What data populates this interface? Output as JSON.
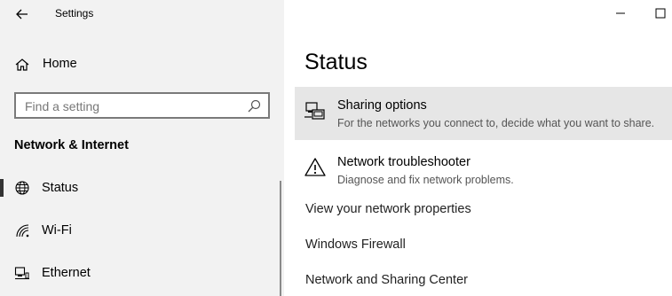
{
  "window": {
    "title": "Settings"
  },
  "sidebar": {
    "home_label": "Home",
    "search_placeholder": "Find a setting",
    "section_heading": "Network & Internet",
    "items": [
      {
        "label": "Status",
        "icon": "globe-icon",
        "selected": true
      },
      {
        "label": "Wi-Fi",
        "icon": "wifi-icon",
        "selected": false
      },
      {
        "label": "Ethernet",
        "icon": "ethernet-icon",
        "selected": false
      }
    ]
  },
  "main": {
    "title": "Status",
    "cards": [
      {
        "title": "Sharing options",
        "description": "For the networks you connect to, decide what you want to share.",
        "icon": "sharing-icon"
      },
      {
        "title": "Network troubleshooter",
        "description": "Diagnose and fix network problems.",
        "icon": "warning-icon"
      }
    ],
    "links": [
      "View your network properties",
      "Windows Firewall",
      "Network and Sharing Center"
    ]
  },
  "colors": {
    "sidebar_bg": "#f2f2f2",
    "hover_bg": "#e6e6e6",
    "selected_indicator": "#333333"
  }
}
